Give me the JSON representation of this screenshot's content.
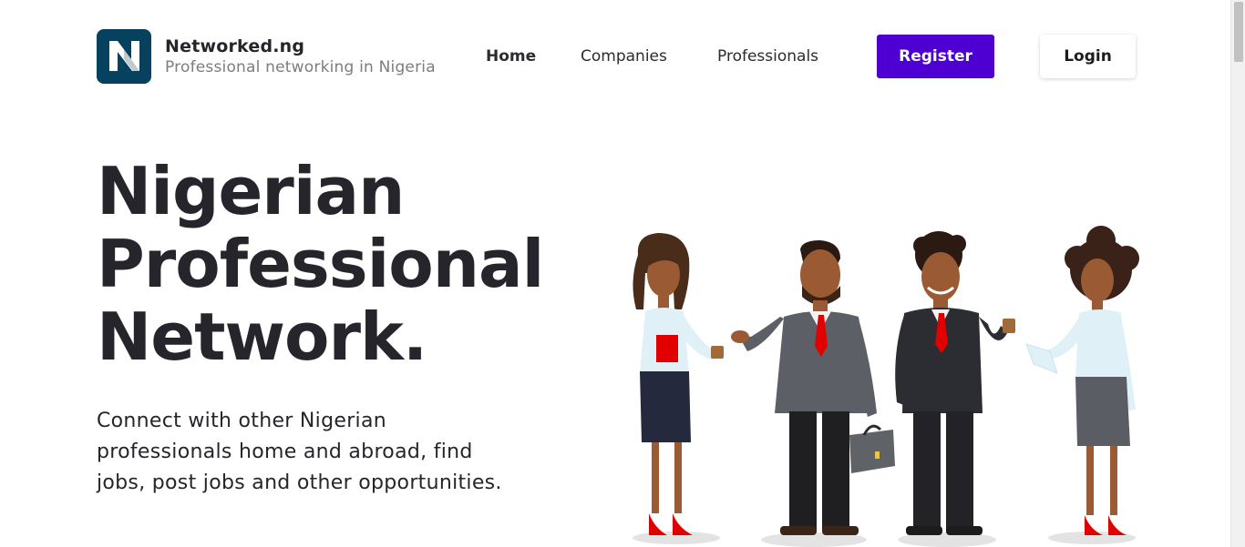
{
  "brand": {
    "name": "Networked.ng",
    "tagline": "Professional networking in Nigeria",
    "logo_letter": "N",
    "logo_color": "#06425f"
  },
  "nav": {
    "home": "Home",
    "companies": "Companies",
    "professionals": "Professionals",
    "register": "Register",
    "login": "Login"
  },
  "hero": {
    "title_line1": "Nigerian",
    "title_line2": "Professional",
    "title_line3": "Network.",
    "subtitle": "Connect with other Nigerian professionals home and abroad, find jobs, post jobs and other opportunities."
  },
  "colors": {
    "accent": "#4d00d1",
    "text": "#26252b",
    "muted": "#7c7c82"
  }
}
